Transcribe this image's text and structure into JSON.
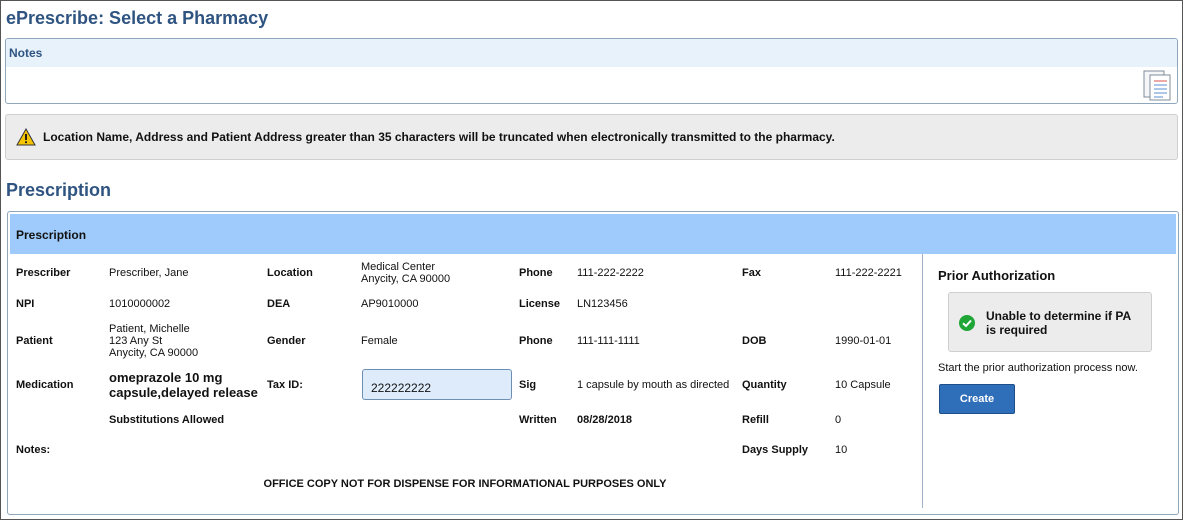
{
  "page": {
    "title": "ePrescribe: Select a Pharmacy"
  },
  "notes": {
    "header": "Notes",
    "icon": "notes-document-icon"
  },
  "warning": {
    "icon": "warning-icon",
    "text": "Location Name, Address and Patient Address greater than 35 characters will be truncated when electronically transmitted to the pharmacy."
  },
  "prescription": {
    "heading": "Prescription",
    "panel_header": "Prescription",
    "labels": {
      "prescriber": "Prescriber",
      "location": "Location",
      "phone": "Phone",
      "fax": "Fax",
      "npi": "NPI",
      "dea": "DEA",
      "license": "License",
      "patient": "Patient",
      "gender": "Gender",
      "patient_phone": "Phone",
      "dob": "DOB",
      "medication": "Medication",
      "tax_id": "Tax ID:",
      "sig": "Sig",
      "quantity": "Quantity",
      "substitutions": "Substitutions Allowed",
      "written": "Written",
      "refill": "Refill",
      "notes": "Notes:",
      "days_supply": "Days Supply"
    },
    "values": {
      "prescriber": "Prescriber, Jane",
      "location_line1": "Medical Center",
      "location_line2": "Anycity, CA 90000",
      "phone": "111-222-2222",
      "fax": "111-222-2221",
      "npi": "1010000002",
      "dea": "AP9010000",
      "license": "LN123456",
      "patient_line1": "Patient, Michelle",
      "patient_line2": "123 Any St",
      "patient_line3": "Anycity, CA 90000",
      "gender": "Female",
      "patient_phone": "111-111-1111",
      "dob": "1990-01-01",
      "medication_line1": "omeprazole 10 mg",
      "medication_line2": "capsule,delayed release",
      "tax_id": "222222222",
      "sig": "1 capsule by mouth as directed",
      "quantity": "10 Capsule",
      "written": "08/28/2018",
      "refill": "0",
      "days_supply": "10"
    },
    "footer": "OFFICE COPY NOT FOR DISPENSE FOR INFORMATIONAL PURPOSES ONLY"
  },
  "prior_authorization": {
    "title": "Prior Authorization",
    "status_icon": "check-circle-icon",
    "status_text": "Unable to determine if PA is required",
    "description": "Start the prior authorization process now.",
    "button": "Create"
  },
  "colors": {
    "title": "#2f5481",
    "panel_header": "#9ecbfb",
    "notes_header": "#e7f2fb",
    "button": "#2f6eb9",
    "success": "#1fa637",
    "warning": "#f5c400"
  }
}
